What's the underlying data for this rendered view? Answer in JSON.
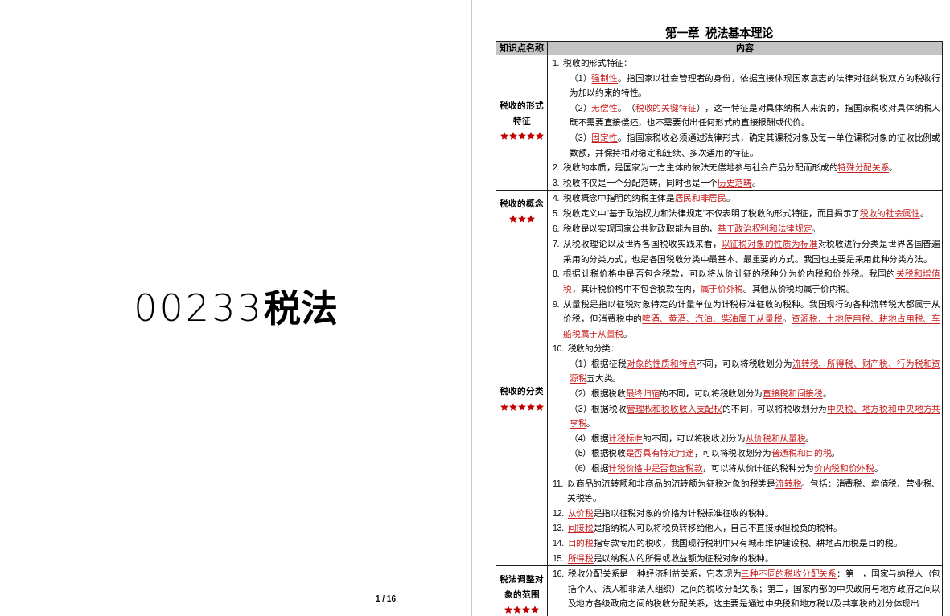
{
  "cover": {
    "title": "00233**税法**",
    "page_number": "1 / 16"
  },
  "chapter_title": "第一章  税法基本理论",
  "table": {
    "columns": [
      "知识点名称",
      "内容"
    ],
    "rows": [
      {
        "topic": "税收的形式特征",
        "stars": 5,
        "items": [
          {
            "number": "1.",
            "segments": [
              {
                "text": "税收的形式特征：",
                "emphasis": false
              }
            ],
            "subitems": [
              {
                "segments": [
                  {
                    "text": "（1）",
                    "emphasis": false
                  },
                  {
                    "text": "强制性",
                    "emphasis": true
                  },
                  {
                    "text": "。指国家以社会管理者的身份，依据直接体现国家意志的法律对征纳税双方的税收行为加以约束的特性。",
                    "emphasis": false
                  }
                ]
              },
              {
                "segments": [
                  {
                    "text": "（2）",
                    "emphasis": false
                  },
                  {
                    "text": "无偿性",
                    "emphasis": true
                  },
                  {
                    "text": "。（",
                    "emphasis": false
                  },
                  {
                    "text": "税收的关键特征",
                    "emphasis": true
                  },
                  {
                    "text": "），这一特征是对具体纳税人来说的，指国家税收对具体纳税人既不需要直接偿还，也不需要付出任何形式的直接报酬或代价。",
                    "emphasis": false
                  }
                ]
              },
              {
                "segments": [
                  {
                    "text": "（3）",
                    "emphasis": false
                  },
                  {
                    "text": "固定性",
                    "emphasis": true
                  },
                  {
                    "text": "。指国家税收必须通过法律形式，确定其课税对象及每一单位课税对象的征收比例或数额，并保持相对稳定和连续、多次适用的特征。",
                    "emphasis": false
                  }
                ]
              }
            ]
          },
          {
            "number": "2.",
            "segments": [
              {
                "text": "税收的本质，是国家为一方主体的依法无偿地参与社会产品分配而形成的",
                "emphasis": false
              },
              {
                "text": "特殊分配关系",
                "emphasis": true
              },
              {
                "text": "。",
                "emphasis": false
              }
            ]
          },
          {
            "number": "3.",
            "segments": [
              {
                "text": "税收不仅是一个分配范畴，同时也是一个",
                "emphasis": false
              },
              {
                "text": "历史范畴",
                "emphasis": true
              },
              {
                "text": "。",
                "emphasis": false
              }
            ]
          }
        ]
      },
      {
        "topic": "税收的概念",
        "stars": 3,
        "items": [
          {
            "number": "4.",
            "segments": [
              {
                "text": "税收概念中指明的纳税主体是",
                "emphasis": false
              },
              {
                "text": "居民和非居民",
                "emphasis": true
              },
              {
                "text": "。",
                "emphasis": false
              }
            ]
          },
          {
            "number": "5.",
            "segments": [
              {
                "text": "税收定义中“基于政治权力和法律规定”不仅表明了税收的形式特征，而且揭示了",
                "emphasis": false
              },
              {
                "text": "税收的社会属性",
                "emphasis": true
              },
              {
                "text": "。",
                "emphasis": false
              }
            ]
          },
          {
            "number": "6.",
            "segments": [
              {
                "text": "税收是以实现国家公共财政职能为目的，",
                "emphasis": false
              },
              {
                "text": "基于政治权利和法律规定",
                "emphasis": true
              },
              {
                "text": "。",
                "emphasis": false
              }
            ]
          }
        ]
      },
      {
        "topic": "税收的分类",
        "stars": 5,
        "items": [
          {
            "number": "7.",
            "segments": [
              {
                "text": "从税收理论以及世界各国税收实践来看，",
                "emphasis": false
              },
              {
                "text": "以征税对象的性质为标准",
                "emphasis": true
              },
              {
                "text": "对税收进行分类是世界各国普遍采用的分类方式，也是各国税收分类中最基本、最重要的方式。我国也主要是采用此种分类方法。",
                "emphasis": false
              }
            ]
          },
          {
            "number": "8.",
            "segments": [
              {
                "text": "根据计税价格中是否包含税款，可以将从价计征的税种分为价内税和价外税。我国的",
                "emphasis": false
              },
              {
                "text": "关税和增值税",
                "emphasis": true
              },
              {
                "text": "，其计税价格中不包含税款在内，",
                "emphasis": false
              },
              {
                "text": "属于价外税",
                "emphasis": true
              },
              {
                "text": "。其他从价税均属于价内税。",
                "emphasis": false
              }
            ]
          },
          {
            "number": "9.",
            "segments": [
              {
                "text": "从量税是指以征税对象特定的计量单位为计税标准征收的税种。我国现行的各种流转税大都属于从价税，但消费税中的",
                "emphasis": false
              },
              {
                "text": "啤酒、黄酒、汽油、柴油属于从量税",
                "emphasis": true
              },
              {
                "text": "。",
                "emphasis": false
              },
              {
                "text": "资源税、土地使用税、耕地占用税、车船税属于从量税",
                "emphasis": true
              },
              {
                "text": "。",
                "emphasis": false
              }
            ]
          },
          {
            "number": "10.",
            "segments": [
              {
                "text": "税收的分类：",
                "emphasis": false
              }
            ],
            "subitems": [
              {
                "segments": [
                  {
                    "text": "（1）根据征税",
                    "emphasis": false
                  },
                  {
                    "text": "对象的性质和特点",
                    "emphasis": true
                  },
                  {
                    "text": "不同，可以将税收划分为",
                    "emphasis": false
                  },
                  {
                    "text": "流转税、所得税、财产税、行为税和资源税",
                    "emphasis": true
                  },
                  {
                    "text": "五大类。",
                    "emphasis": false
                  }
                ]
              },
              {
                "segments": [
                  {
                    "text": "（2）根据税收",
                    "emphasis": false
                  },
                  {
                    "text": "最终归宿",
                    "emphasis": true
                  },
                  {
                    "text": "的不同，可以将税收划分为",
                    "emphasis": false
                  },
                  {
                    "text": "直接税和间接税",
                    "emphasis": true
                  },
                  {
                    "text": "。",
                    "emphasis": false
                  }
                ]
              },
              {
                "segments": [
                  {
                    "text": "（3）根据税收",
                    "emphasis": false
                  },
                  {
                    "text": "管理权和税收收入支配权",
                    "emphasis": true
                  },
                  {
                    "text": "的不同，可以将税收划分为",
                    "emphasis": false
                  },
                  {
                    "text": "中央税、地方税和中央地方共享税",
                    "emphasis": true
                  },
                  {
                    "text": "。",
                    "emphasis": false
                  }
                ]
              },
              {
                "segments": [
                  {
                    "text": "（4）根据",
                    "emphasis": false
                  },
                  {
                    "text": "计税标准",
                    "emphasis": true
                  },
                  {
                    "text": "的不同，可以将税收划分为",
                    "emphasis": false
                  },
                  {
                    "text": "从价税和从量税",
                    "emphasis": true
                  },
                  {
                    "text": "。",
                    "emphasis": false
                  }
                ]
              },
              {
                "segments": [
                  {
                    "text": "（5）根据税收",
                    "emphasis": false
                  },
                  {
                    "text": "是否具有特定用途",
                    "emphasis": true
                  },
                  {
                    "text": "，可以将税收划分为",
                    "emphasis": false
                  },
                  {
                    "text": "普通税和目的税",
                    "emphasis": true
                  },
                  {
                    "text": "。",
                    "emphasis": false
                  }
                ]
              },
              {
                "segments": [
                  {
                    "text": "（6）根据",
                    "emphasis": false
                  },
                  {
                    "text": "计税价格中是否包含税款",
                    "emphasis": true
                  },
                  {
                    "text": "，可以将从价计征的税种分为",
                    "emphasis": false
                  },
                  {
                    "text": "价内税和价外税",
                    "emphasis": true
                  },
                  {
                    "text": "。",
                    "emphasis": false
                  }
                ]
              }
            ]
          },
          {
            "number": "11.",
            "segments": [
              {
                "text": "以商品的流转额和非商品的流转额为征税对象的税类是",
                "emphasis": false
              },
              {
                "text": "流转税",
                "emphasis": true
              },
              {
                "text": "。包括：消费税、增值税、营业税、关税等。",
                "emphasis": false
              }
            ]
          },
          {
            "number": "12.",
            "segments": [
              {
                "text": "从价税",
                "emphasis": true
              },
              {
                "text": "是指以征税对象的价格为计税标准征收的税种。",
                "emphasis": false
              }
            ]
          },
          {
            "number": "13.",
            "segments": [
              {
                "text": "间接税",
                "emphasis": true
              },
              {
                "text": "是指纳税人可以将税负转移给他人，自己不直接承担税负的税种。",
                "emphasis": false
              }
            ]
          },
          {
            "number": "14.",
            "segments": [
              {
                "text": "目的税",
                "emphasis": true
              },
              {
                "text": "指专款专用的税收，我国现行税制中只有城市维护建设税、耕地占用税是目的税。",
                "emphasis": false
              }
            ]
          },
          {
            "number": "15.",
            "segments": [
              {
                "text": "所得税",
                "emphasis": true
              },
              {
                "text": "是以纳税人的所得或收益额为征税对象的税种。",
                "emphasis": false
              }
            ]
          }
        ]
      },
      {
        "topic": "税法调整对象的范围",
        "stars": 4,
        "items": [
          {
            "number": "16.",
            "segments": [
              {
                "text": "税收分配关系是一种经济利益关系，它表现为",
                "emphasis": false
              },
              {
                "text": "三种不同的税收分配关系",
                "emphasis": true
              },
              {
                "text": "：第一，国家与纳税人（包括个人、法人和非法人组织）之间的税收分配关系；第二，国家内部的中央政府与地方政府之间以及地方各级政府之间的税收分配关系，这主要是通过中央税和地方税以及共享税的划分体现出",
                "emphasis": false
              }
            ]
          }
        ]
      }
    ]
  }
}
